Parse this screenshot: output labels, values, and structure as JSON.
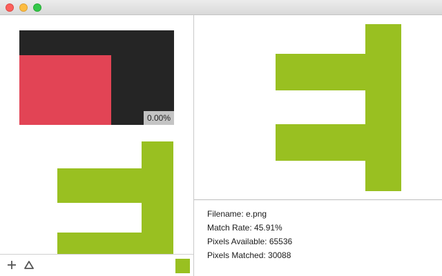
{
  "window": {
    "traffic_lights": [
      "close",
      "minimize",
      "zoom"
    ]
  },
  "preview": {
    "background_color": "#252525",
    "overlay_color": "#e24455",
    "match_badge": "0.00%"
  },
  "glyph": {
    "color": "#99c021"
  },
  "toolbar": {
    "add_icon": "plus-icon",
    "triangle_icon": "triangle-icon",
    "swatch_color": "#99c021"
  },
  "info": {
    "filename": "Filename: e.png",
    "match_rate": "Match Rate: 45.91%",
    "pixels_available": "Pixels Available: 65536",
    "pixels_matched": "Pixels Matched: 30088"
  }
}
